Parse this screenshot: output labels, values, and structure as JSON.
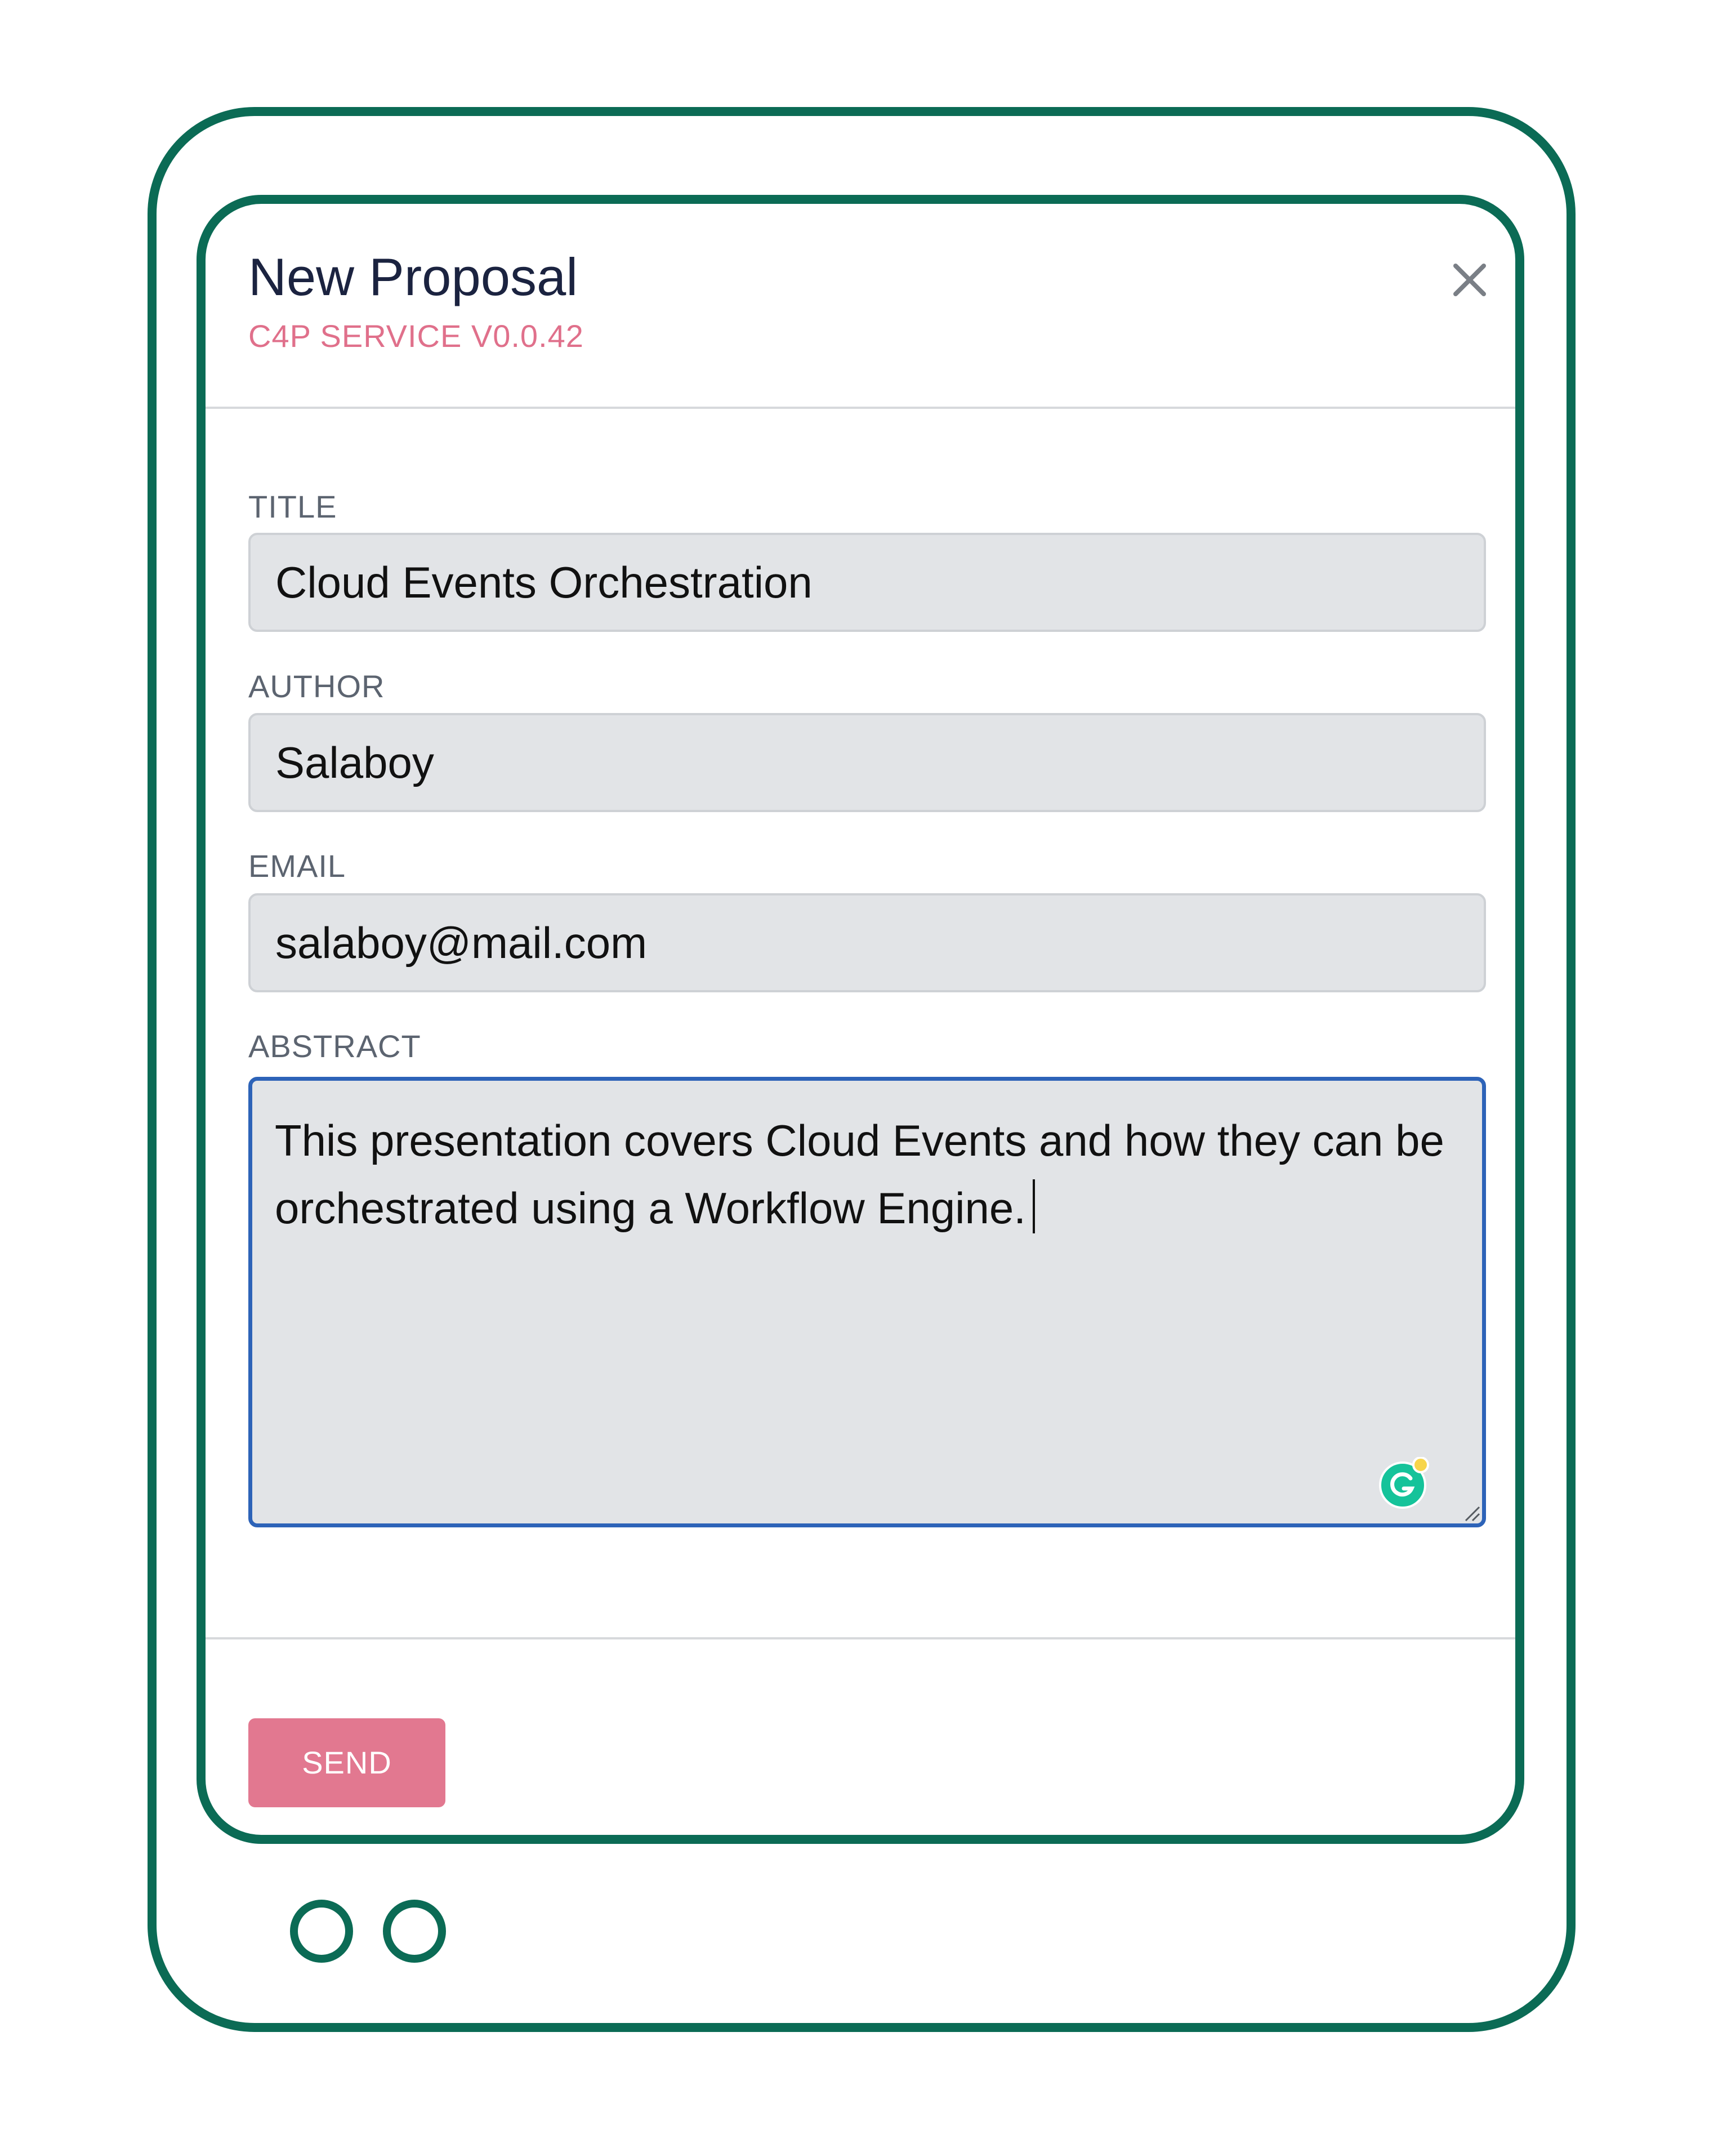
{
  "modal": {
    "title": "New Proposal",
    "subtitle": "C4P SERVICE V0.0.42",
    "close_icon": "close-icon"
  },
  "form": {
    "title_label": "TITLE",
    "title_value": "Cloud Events Orchestration",
    "author_label": "AUTHOR",
    "author_value": "Salaboy",
    "email_label": "EMAIL",
    "email_value": "salaboy@mail.com",
    "abstract_label": "ABSTRACT",
    "abstract_value": "This presentation covers Cloud Events and how they can be orchestrated using a Workflow Engine."
  },
  "footer": {
    "send_label": "SEND"
  },
  "icons": {
    "grammarly": "grammarly-icon",
    "resize": "resize-handle-icon"
  },
  "colors": {
    "frame": "#0b6b55",
    "accent": "#e27890",
    "subtitle": "#e0708b",
    "focus_border": "#2d63b8",
    "field_bg": "#e2e4e7",
    "title_text": "#1b2340"
  }
}
